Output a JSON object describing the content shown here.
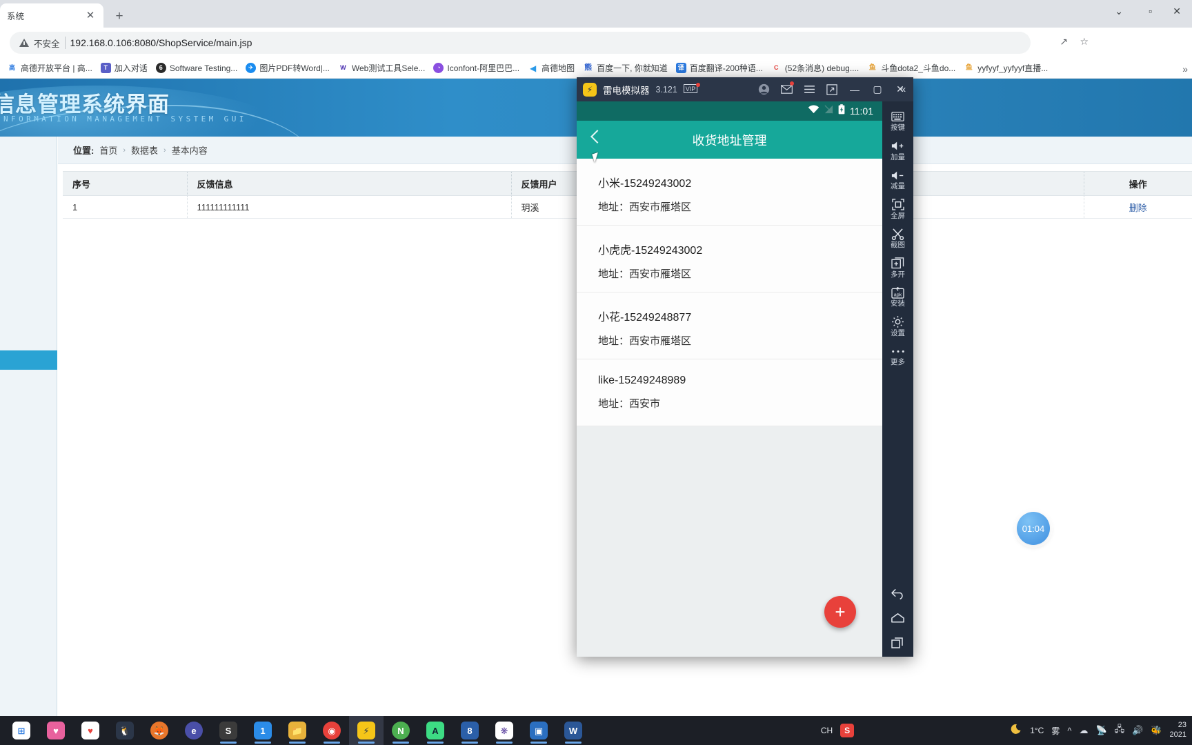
{
  "browser": {
    "tab_title": "系统",
    "tab_close_icon": "close-icon",
    "new_tab_icon": "plus-icon",
    "window_minimize": "⌄",
    "window_maximize": "▫",
    "window_close": "✕",
    "security_label": "不安全",
    "url": "192.168.0.106:8080/ShopService/main.jsp",
    "share_icon": "↗",
    "star_icon": "☆",
    "bookmarks_overflow": "»",
    "bookmarks": [
      {
        "label": "高德开放平台 | 高...",
        "icon_text": "",
        "icon_color": "#ffffff",
        "icon_name": "amap-open-icon"
      },
      {
        "label": "加入对话",
        "icon_text": "T",
        "icon_color": "#5a5fc7",
        "icon_name": "teams-icon"
      },
      {
        "label": "Software Testing...",
        "icon_text": "6",
        "icon_color": "#2b2b2b",
        "icon_name": "software-testing-icon"
      },
      {
        "label": "图片PDF转Word|...",
        "icon_text": "✈",
        "icon_color": "#1a8cf0",
        "icon_name": "pdf-convert-icon"
      },
      {
        "label": "Web测试工具Sele...",
        "icon_text": "W",
        "icon_color": "#ffffff",
        "icon_name": "selenium-icon"
      },
      {
        "label": "Iconfont-阿里巴巴...",
        "icon_text": "◔",
        "icon_color": "#8a4fe0",
        "icon_name": "iconfont-icon"
      },
      {
        "label": "高德地图",
        "icon_text": "◀",
        "icon_color": "#ffffff",
        "icon_name": "amap-icon"
      },
      {
        "label": "百度一下, 你就知道",
        "icon_text": "熊",
        "icon_color": "#ffffff",
        "icon_name": "baidu-icon"
      },
      {
        "label": "百度翻译-200种语...",
        "icon_text": "译",
        "icon_color": "#2b7ae0",
        "icon_name": "baidu-translate-icon"
      },
      {
        "label": "(52条消息) debug....",
        "icon_text": "C",
        "icon_color": "#ffffff",
        "icon_name": "csdn-icon"
      },
      {
        "label": "斗鱼dota2_斗鱼do...",
        "icon_text": "鱼",
        "icon_color": "#ffffff",
        "icon_name": "douyu-icon"
      },
      {
        "label": "yyfyyf_yyfyyf直播...",
        "icon_text": "鱼",
        "icon_color": "#ffffff",
        "icon_name": "douyu-icon"
      }
    ]
  },
  "webpage": {
    "banner_title": "信息管理系统界面",
    "banner_subtitle": "INFORMATION MANAGEMENT SYSTEM GUI",
    "breadcrumb": {
      "label": "位置:",
      "items": [
        "首页",
        "数据表",
        "基本内容"
      ],
      "separator": "›"
    },
    "table": {
      "columns": [
        "序号",
        "反馈信息",
        "反馈用户",
        "操作"
      ],
      "rows": [
        {
          "index": "1",
          "feedback": "111111111111",
          "user": "玥溪",
          "action": "删除"
        }
      ]
    }
  },
  "emulator": {
    "app_name": "雷电模拟器",
    "version": "3.121",
    "logo_text": "⚡",
    "vip_badge": "VIP",
    "icons": {
      "account": "account-icon",
      "mail": "mail-icon",
      "menu": "hamburger-menu-icon",
      "resize": "resize-icon",
      "minimize": "minimize-icon",
      "maximize": "maximize-icon",
      "close": "close-icon",
      "collapse": "collapse-icon"
    },
    "title_buttons": {
      "minimize": "—",
      "maximize": "▢",
      "close": "✕",
      "collapse": "«"
    },
    "status_bar": {
      "wifi_icon": "wifi-icon",
      "signal_icon": "signal-icon",
      "battery_icon": "battery-charging-icon",
      "time": "11:01"
    },
    "app": {
      "title": "收货地址管理",
      "back_icon": "back-chevron-icon",
      "add_button_label": "+",
      "addresses": [
        {
          "name": "小米-15249243002",
          "address": "地址：西安市雁塔区"
        },
        {
          "name": "小虎虎-15249243002",
          "address": "地址：西安市雁塔区"
        },
        {
          "name": "小花-15249248877",
          "address": "地址：西安市雁塔区"
        },
        {
          "name": "like-15249248989",
          "address": "地址：西安市"
        }
      ]
    },
    "sidebar": [
      {
        "label": "按键",
        "icon": "keyboard-icon"
      },
      {
        "label": "加量",
        "icon": "volume-up-icon"
      },
      {
        "label": "减量",
        "icon": "volume-down-icon"
      },
      {
        "label": "全屏",
        "icon": "fullscreen-icon"
      },
      {
        "label": "截图",
        "icon": "scissors-screenshot-icon"
      },
      {
        "label": "多开",
        "icon": "multi-instance-icon"
      },
      {
        "label": "安装",
        "icon": "install-apk-icon"
      },
      {
        "label": "设置",
        "icon": "gear-icon"
      },
      {
        "label": "更多",
        "icon": "more-dots-icon"
      }
    ],
    "nav_buttons": [
      {
        "icon": "back-arrow-icon",
        "glyph": "↩"
      },
      {
        "icon": "home-icon",
        "glyph": "⌂"
      },
      {
        "icon": "recents-icon",
        "glyph": "❐"
      }
    ]
  },
  "overlay": {
    "timer_value": "01:04"
  },
  "taskbar": {
    "apps": [
      {
        "name": "microsoft-store",
        "text": "",
        "color": "#ffffff",
        "running": false,
        "active": false
      },
      {
        "name": "game-app",
        "text": "",
        "color": "#e8619d",
        "running": false,
        "active": false
      },
      {
        "name": "wps-app",
        "text": "",
        "color": "#e8413b",
        "running": false,
        "active": false
      },
      {
        "name": "qq-app",
        "text": "",
        "color": "#2b3648",
        "running": false,
        "active": false
      },
      {
        "name": "firefox-app",
        "text": "",
        "color": "#e8762b",
        "running": false,
        "active": false
      },
      {
        "name": "edge-app",
        "text": "",
        "color": "#4a4fa8",
        "running": false,
        "active": false
      },
      {
        "name": "sublime-app",
        "text": "S",
        "color": "#3b3b3b",
        "running": true,
        "active": false
      },
      {
        "name": "notes-app",
        "text": "1",
        "color": "#2b8ce8",
        "running": true,
        "active": false
      },
      {
        "name": "file-explorer",
        "text": "",
        "color": "#e8b23b",
        "running": true,
        "active": false
      },
      {
        "name": "chrome-app",
        "text": "",
        "color": "#e8413b",
        "running": true,
        "active": false
      },
      {
        "name": "ldplayer-app",
        "text": "⚡",
        "color": "#f5c518",
        "running": true,
        "active": true
      },
      {
        "name": "navicat-app",
        "text": "",
        "color": "#4caf50",
        "running": true,
        "active": false
      },
      {
        "name": "android-studio-app",
        "text": "A",
        "color": "#3ddc84",
        "running": true,
        "active": false
      },
      {
        "name": "idea-app",
        "text": "8",
        "color": "#2b5fa8",
        "running": true,
        "active": false
      },
      {
        "name": "eclipse-app",
        "text": "",
        "color": "#5a3f9e",
        "running": true,
        "active": false
      },
      {
        "name": "photos-app",
        "text": "",
        "color": "#2b6fc0",
        "running": true,
        "active": false
      },
      {
        "name": "word-app",
        "text": "W",
        "color": "#2b5797",
        "running": true,
        "active": false
      }
    ],
    "ime_label": "CH",
    "ime_icon": "sogou-input-icon",
    "weather_icon": "fog-moon-icon",
    "weather_temp": "1°C",
    "weather_desc": "雾",
    "tray_icons": [
      "^",
      "☁",
      "🖧",
      "🖥",
      "🔊",
      "🐝"
    ],
    "clock_time": "23",
    "clock_date": "2021"
  }
}
